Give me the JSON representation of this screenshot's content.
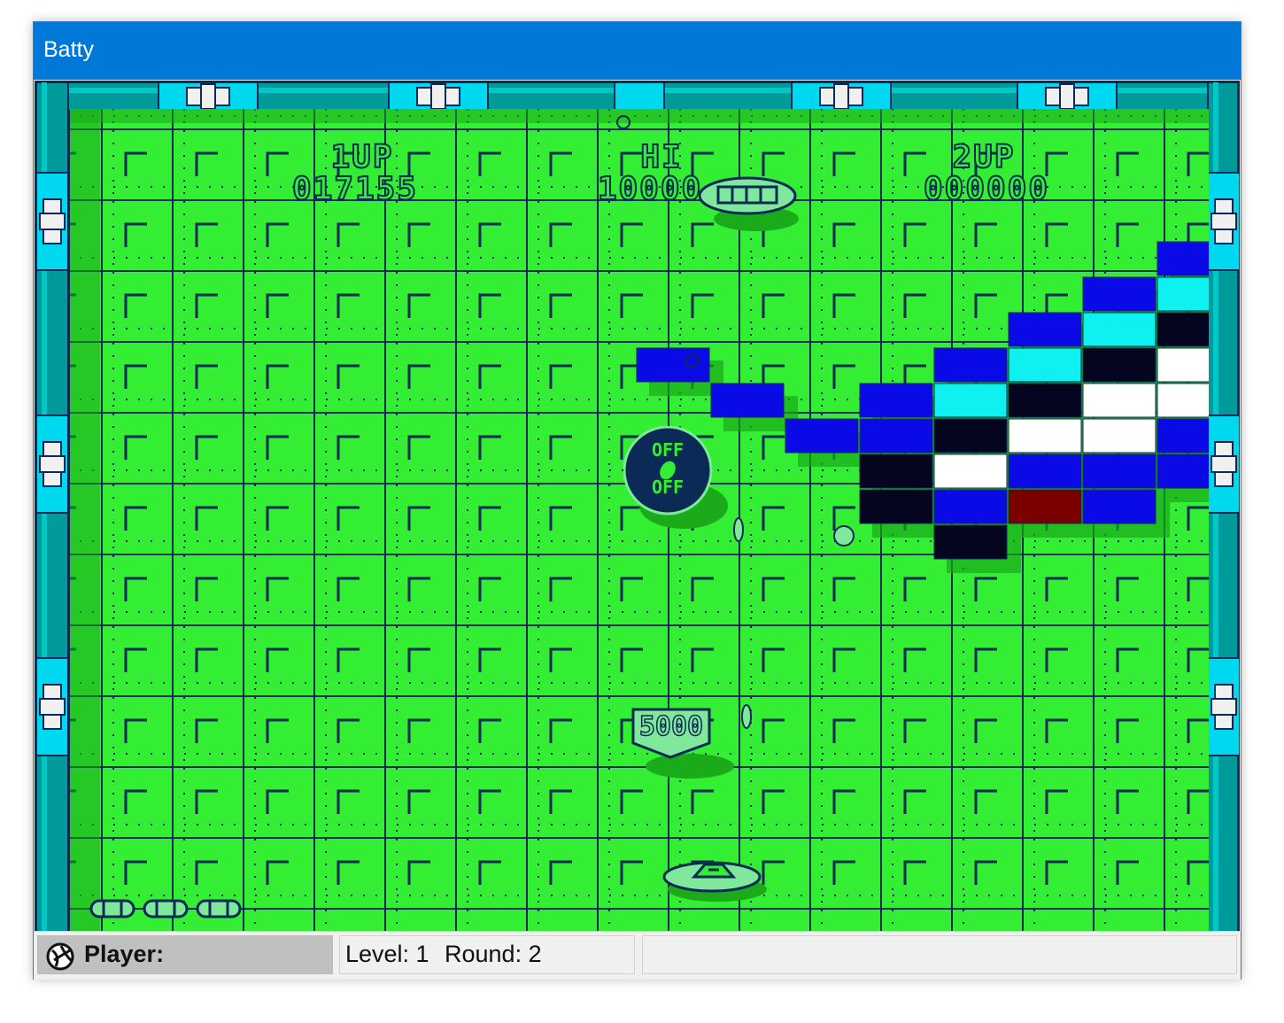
{
  "window": {
    "title": "Batty"
  },
  "hud": {
    "p1_label": "1UP",
    "p1_score": "017155",
    "hi_label": "HI",
    "hi_score": "10000",
    "p2_label": "2UP",
    "p2_score": "000000"
  },
  "game": {
    "bonus_value": "5000",
    "powerup_text": "OFF OFF",
    "lives_remaining": 3,
    "brick_colors": {
      "blue": "#0a0ae6",
      "cyan": "#0ff0f0",
      "black": "#050520",
      "white": "#ffffff",
      "red": "#7a0000"
    },
    "field_color": "#33ee33",
    "grid_color": "#0b2a55",
    "frame_color": "#009a9a"
  },
  "statusbar": {
    "player_label": "Player:",
    "level_label": "Level: 1",
    "round_label": "Round: 2"
  },
  "icons": {
    "player": "ball-icon"
  }
}
